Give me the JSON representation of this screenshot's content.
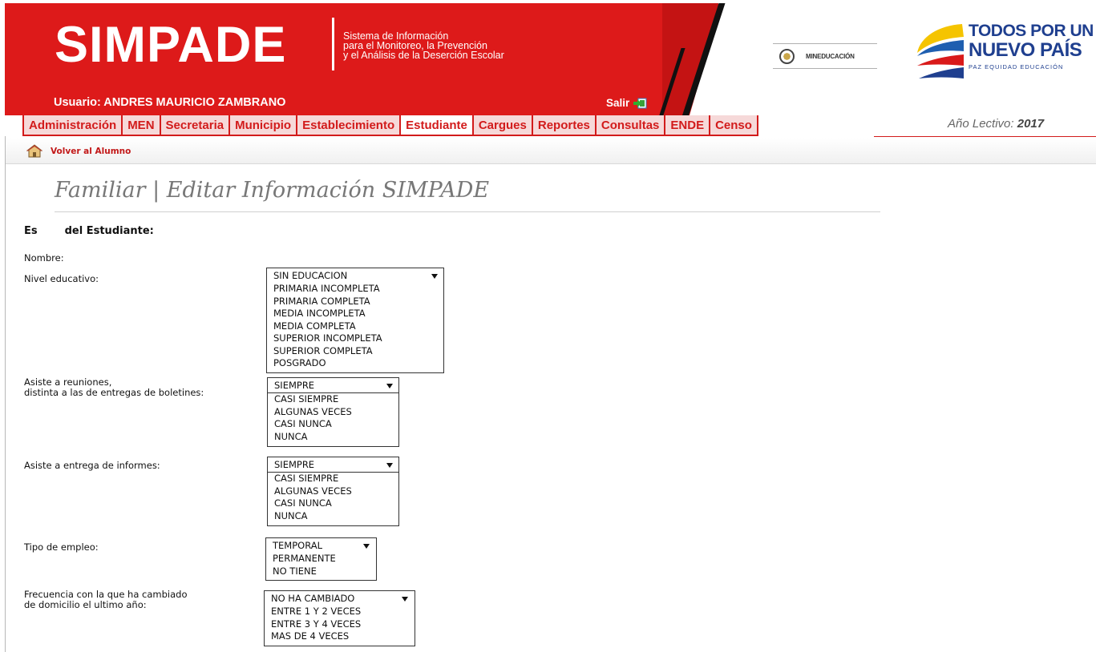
{
  "app": {
    "logo": "SIMPADE",
    "subtitle_lines": [
      "Sistema de Información",
      "para el Monitoreo, la Prevención",
      "y el Análisis de la Deserción Escolar"
    ],
    "user_label": "Usuario: ANDRES MAURICIO ZAMBRANO",
    "logout_label": "Salir",
    "ministry_label": "MINEDUCACIÓN",
    "gov_brand": {
      "line1": "TODOS POR UN",
      "line2": "NUEVO PAÍS",
      "line3": "PAZ  EQUIDAD  EDUCACIÓN"
    }
  },
  "menu": {
    "items": [
      "Administración",
      "MEN",
      "Secretaria",
      "Municipio",
      "Establecimiento",
      "Estudiante",
      "Cargues",
      "Reportes",
      "Consultas",
      "ENDE",
      "Censo"
    ],
    "active": "Estudiante"
  },
  "school_year": {
    "label": "Año Lectivo:",
    "value": "2017"
  },
  "back_link": "Volver al Alumno",
  "page_title": "Familiar | Editar Información SIMPADE",
  "student_header": {
    "part1": "Es",
    "part2": "del Estudiante:"
  },
  "form": {
    "nombre_label": "Nombre:",
    "nivel": {
      "label": "Nivel educativo:",
      "options": [
        "SIN EDUCACION",
        "PRIMARIA INCOMPLETA",
        "PRIMARIA COMPLETA",
        "MEDIA INCOMPLETA",
        "MEDIA COMPLETA",
        "SUPERIOR INCOMPLETA",
        "SUPERIOR COMPLETA",
        "POSGRADO"
      ]
    },
    "reuniones": {
      "label_lines": [
        "Asiste a reuniones,",
        "distinta a las de entregas de boletines:"
      ],
      "options": [
        "SIEMPRE",
        "CASI SIEMPRE",
        "ALGUNAS VECES",
        "CASI NUNCA",
        "NUNCA"
      ]
    },
    "informes": {
      "label": "Asiste a entrega de informes:",
      "options": [
        "SIEMPRE",
        "CASI SIEMPRE",
        "ALGUNAS VECES",
        "CASI NUNCA",
        "NUNCA"
      ]
    },
    "empleo": {
      "label": "Tipo de empleo:",
      "options": [
        "TEMPORAL",
        "PERMANENTE",
        "NO TIENE"
      ]
    },
    "domicilio": {
      "label_lines": [
        "Frecuencia con la que ha cambiado",
        "de domicilio el ultimo año:"
      ],
      "options": [
        "NO HA CAMBIADO",
        "ENTRE 1 Y 2 VECES",
        "ENTRE 3 Y 4 VECES",
        "MAS DE 4 VECES"
      ]
    }
  },
  "colors": {
    "brand_red": "#dd1a1a",
    "menu_red": "#d21b1b",
    "brand_blue": "#1f3f8f"
  }
}
